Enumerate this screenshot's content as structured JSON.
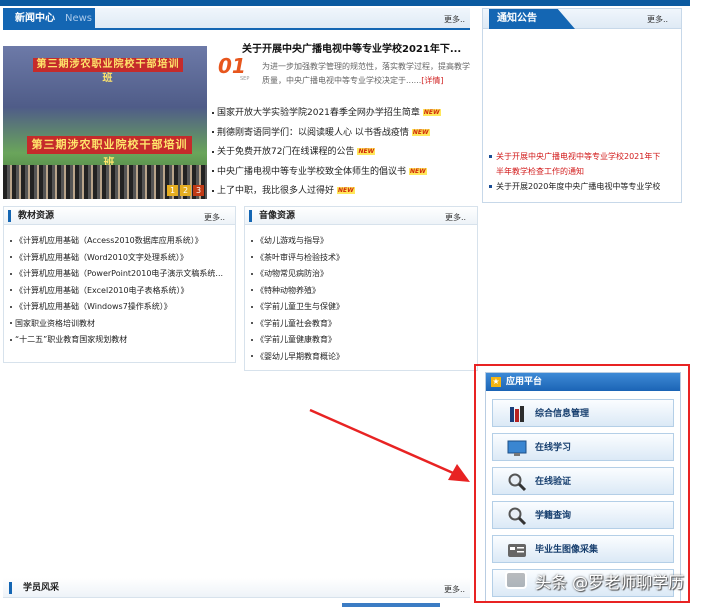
{
  "news": {
    "title": "新闻中心",
    "title_en": "News",
    "more": "更多..",
    "slide": {
      "banner_top": "第三期涉农职业院校干部培训班",
      "banner_main": "第三期涉农职业院校干部培训班",
      "pages": [
        "1",
        "2",
        "3"
      ]
    },
    "headline": "关于开展中央广播电视中等专业学校2021年下...",
    "date_day": "01",
    "date_month": "SEP",
    "summary": "为进一步加强教学管理的规范性，落实教学过程，提高教学质量，中央广播电视中等专业学校决定于......",
    "detail": "[详情]",
    "new_badge": "NEW",
    "items": [
      "国家开放大学实验学院2021春季全网办学招生简章",
      "荆德刚寄语同学们：以阅读暖人心 以书香战疫情",
      "关于免费开放72门在线课程的公告",
      "中央广播电视中等专业学校致全体师生的倡议书",
      "上了中职，我比很多人过得好"
    ]
  },
  "notice": {
    "title": "通知公告",
    "more": "更多..",
    "items": [
      "关于开展中央广播电视中等专业学校2021年下",
      "半年教学检查工作的通知",
      "关于开展2020年度中央广播电视中等专业学校"
    ]
  },
  "textbooks": {
    "title": "教材资源",
    "more": "更多..",
    "items": [
      "《计算机应用基础（Access2010数据库应用系统）》",
      "《计算机应用基础（Word2010文字处理系统）》",
      "《计算机应用基础（PowerPoint2010电子演示文稿系统...",
      "《计算机应用基础（Excel2010电子表格系统）》",
      "《计算机应用基础（Windows7操作系统）》",
      "国家职业资格培训教材",
      "“十二五”职业教育国家规划教材"
    ]
  },
  "media": {
    "title": "音像资源",
    "more": "更多..",
    "items": [
      "《幼儿游戏与指导》",
      "《茶叶审评与检验技术》",
      "《动物常见病防治》",
      "《特种动物养殖》",
      "《学前儿童卫生与保健》",
      "《学前儿童社会教育》",
      "《学前儿童健康教育》",
      "《婴幼儿早期教育概论》"
    ]
  },
  "app": {
    "title": "应用平台",
    "buttons": [
      {
        "label": "综合信息管理",
        "icon": "books-icon"
      },
      {
        "label": "在线学习",
        "icon": "monitor-icon"
      },
      {
        "label": "在线验证",
        "icon": "magnifier-icon"
      },
      {
        "label": "学籍查询",
        "icon": "magnifier-icon"
      },
      {
        "label": "毕业生图像采集",
        "icon": "id-card-icon"
      },
      {
        "label": "",
        "icon": "platform-icon"
      }
    ]
  },
  "students": {
    "title": "学员风采",
    "more": "更多.."
  },
  "watermark": {
    "text": "头条 @罗老师聊学历"
  },
  "colors": {
    "brand_blue": "#1466b3",
    "highlight_red": "#e82323",
    "date_orange": "#e7561d"
  }
}
